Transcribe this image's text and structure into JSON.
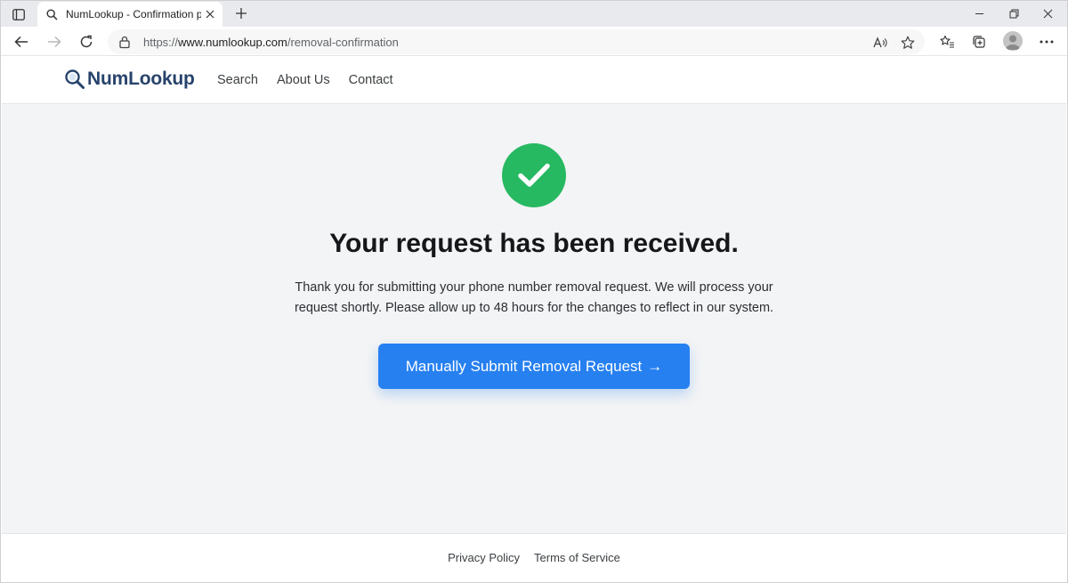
{
  "browser": {
    "tab_title": "NumLookup - Confirmation pag",
    "url_prefix": "https://",
    "url_host": "www.numlookup.com",
    "url_path": "/removal-confirmation"
  },
  "site": {
    "brand": "NumLookup",
    "nav": [
      "Search",
      "About Us",
      "Contact"
    ]
  },
  "confirmation": {
    "headline": "Your request has been received.",
    "message_line1": "Thank you for submitting your phone number removal request. We will process your",
    "message_line2": "request shortly. Please allow up to 48 hours for the changes to reflect in our system.",
    "cta_label": "Manually Submit Removal Request",
    "cta_arrow": "→"
  },
  "footer": {
    "links": [
      "Privacy Policy",
      "Terms of Service"
    ]
  },
  "colors": {
    "success": "#27b862",
    "cta": "#2680f0",
    "brand": "#27436b",
    "page_bg": "#f3f4f5"
  }
}
